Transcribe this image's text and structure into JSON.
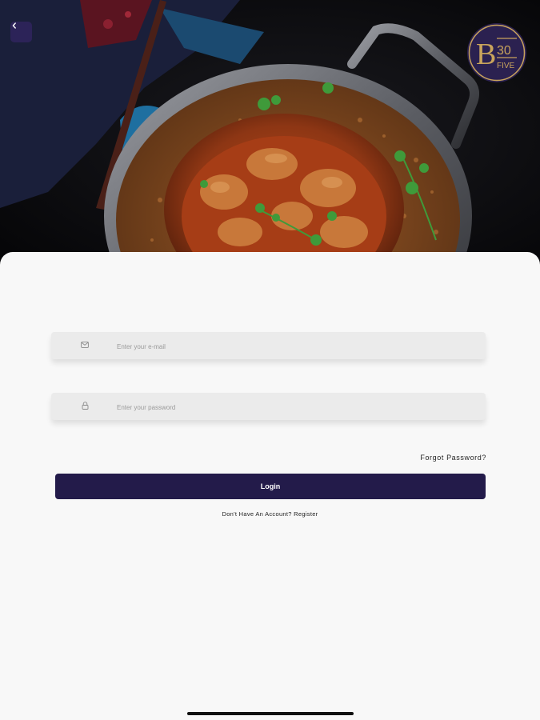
{
  "header": {
    "back_icon": "chevron-left-icon",
    "logo": {
      "letter": "B",
      "number": "30",
      "word": "FIVE",
      "gold": "#c9a45c",
      "navy": "#2b2150"
    }
  },
  "form": {
    "email": {
      "icon": "email-icon",
      "placeholder": "Enter your e-mail",
      "value": ""
    },
    "password": {
      "icon": "lock-icon",
      "placeholder": "Enter your password",
      "value": ""
    },
    "forgot_label": "Forgot  Password?",
    "login_label": "Login",
    "no_account_text": "Don't Have An Account?",
    "register_label": "Register"
  },
  "colors": {
    "primary": "#231b4a",
    "sheet": "#f8f8f8",
    "field": "#ebebeb"
  }
}
